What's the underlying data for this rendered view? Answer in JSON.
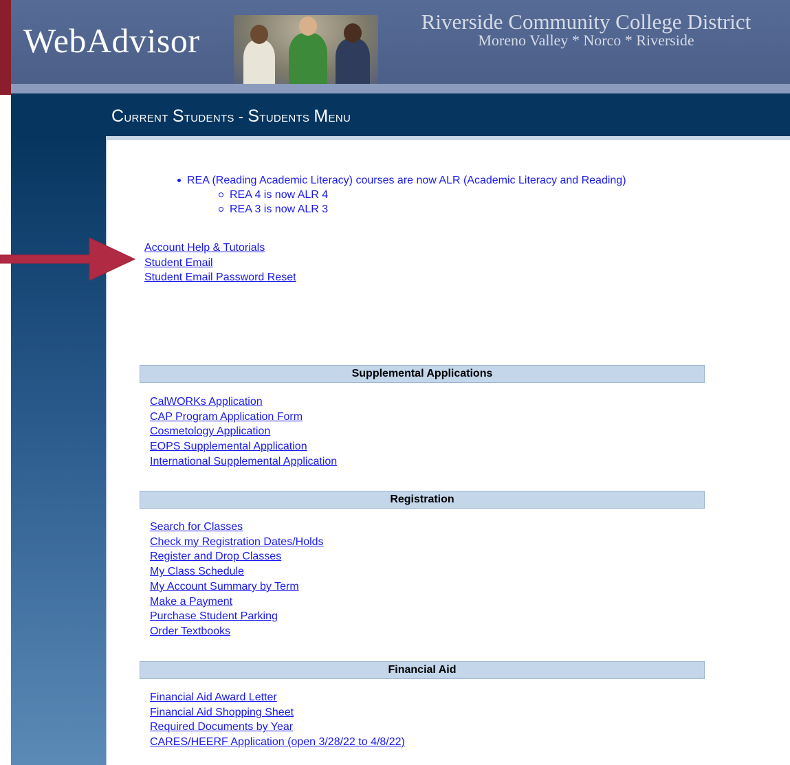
{
  "header": {
    "logo": "WebAdvisor",
    "college_name": "Riverside Community College District",
    "campuses": "Moreno Valley * Norco * Riverside"
  },
  "page_title": {
    "part1_initial": "C",
    "part1_rest": "urrent",
    "part2_initial": "S",
    "part2_rest": "tudents",
    "separator": "-",
    "part3_initial": "S",
    "part3_rest": "tudents",
    "part4_initial": "M",
    "part4_rest": "enu"
  },
  "notice": {
    "main": "REA (Reading Academic Literacy) courses are now ALR (Academic Literacy and Reading)",
    "subs": [
      "REA 4 is now ALR 4",
      "REA 3 is now ALR 3"
    ]
  },
  "top_links": [
    "Account Help & Tutorials",
    "Student Email",
    "Student Email Password Reset"
  ],
  "sections": [
    {
      "title": "Supplemental Applications",
      "links": [
        "CalWORKs Application",
        "CAP Program Application Form",
        "Cosmetology Application",
        "EOPS Supplemental Application",
        "International Supplemental Application"
      ]
    },
    {
      "title": "Registration",
      "links": [
        "Search for Classes",
        "Check my Registration Dates/Holds",
        "Register and Drop Classes",
        "My Class Schedule",
        "My Account Summary by Term",
        "Make a Payment",
        "Purchase Student Parking",
        "Order Textbooks"
      ]
    },
    {
      "title": "Financial Aid",
      "links": [
        "Financial Aid Award Letter",
        "Financial Aid Shopping Sheet",
        "Required Documents by Year",
        "CARES/HEERF Application (open 3/28/22 to 4/8/22)"
      ]
    }
  ],
  "colors": {
    "maroon": "#8b1e2d",
    "navy": "#06355f",
    "link": "#1a1aee",
    "section_bg": "#c3d6ea"
  }
}
